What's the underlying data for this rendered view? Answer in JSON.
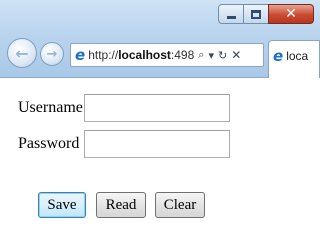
{
  "browser": {
    "address": {
      "url_prefix": "http://",
      "url_host": "localhost",
      "url_suffix": ":498",
      "search_glyph": "⌕",
      "dropdown_glyph": "▾",
      "refresh_glyph": "↻",
      "stop_glyph": "✕"
    },
    "tab_title": "loca",
    "icons": {
      "back": "arrow-left",
      "forward": "arrow-right",
      "favicon": "ie-logo"
    }
  },
  "form": {
    "username_label": "Username",
    "username_value": "",
    "password_label": "Password",
    "password_value": ""
  },
  "buttons": {
    "save": "Save",
    "read": "Read",
    "clear": "Clear"
  },
  "colors": {
    "chrome": "#bad4ee",
    "close_button": "#c94b32",
    "focused_button": "#3c7fb1"
  }
}
